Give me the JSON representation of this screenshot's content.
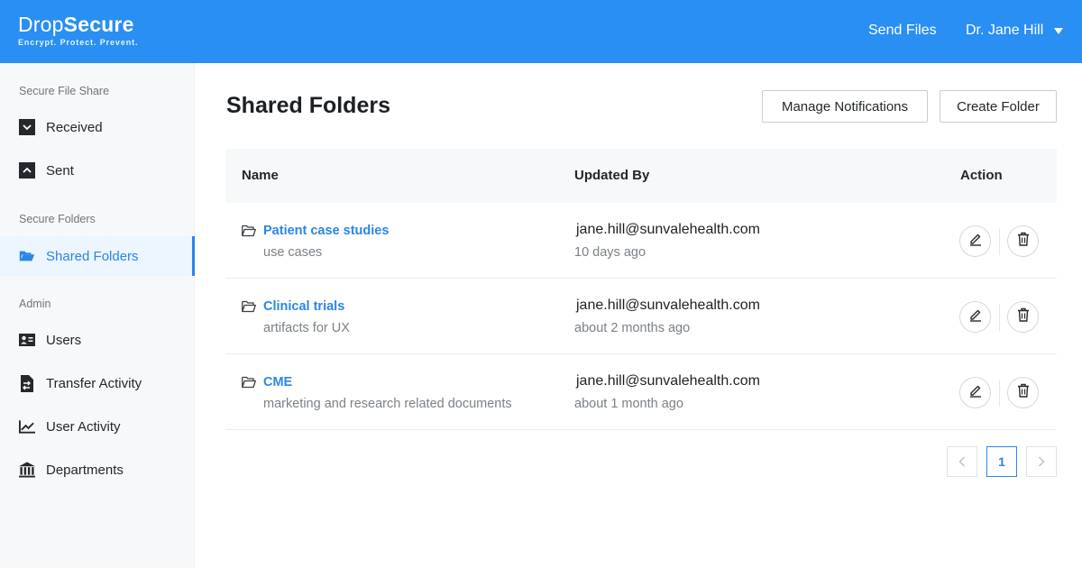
{
  "brand": {
    "name_light": "Drop",
    "name_bold": "Secure",
    "tagline": "Encrypt. Protect. Prevent."
  },
  "header": {
    "send_files": "Send Files",
    "user_name": "Dr. Jane Hill"
  },
  "sidebar": {
    "sections": [
      {
        "label": "Secure File Share"
      },
      {
        "label": "Secure Folders"
      },
      {
        "label": "Admin"
      }
    ],
    "items": [
      {
        "label": "Received",
        "icon": "chevron-down-square-icon"
      },
      {
        "label": "Sent",
        "icon": "chevron-up-square-icon"
      },
      {
        "label": "Shared Folders",
        "icon": "folder-open-icon",
        "active": true
      },
      {
        "label": "Users",
        "icon": "id-card-icon"
      },
      {
        "label": "Transfer Activity",
        "icon": "file-transfer-icon"
      },
      {
        "label": "User Activity",
        "icon": "line-chart-icon"
      },
      {
        "label": "Departments",
        "icon": "bank-icon"
      }
    ]
  },
  "main": {
    "title": "Shared Folders",
    "buttons": {
      "manage_notifications": "Manage Notifications",
      "create_folder": "Create Folder"
    },
    "table": {
      "columns": [
        "Name",
        "Updated By",
        "Action"
      ],
      "rows": [
        {
          "name": "Patient case studies",
          "description": "use cases",
          "updated_by": "jane.hill@sunvalehealth.com",
          "updated": "10 days ago"
        },
        {
          "name": "Clinical trials",
          "description": "artifacts for UX",
          "updated_by": "jane.hill@sunvalehealth.com",
          "updated": "about 2 months ago"
        },
        {
          "name": "CME",
          "description": "marketing and research related documents",
          "updated_by": "jane.hill@sunvalehealth.com",
          "updated": "about 1 month ago"
        }
      ]
    },
    "pagination": {
      "current_page": "1"
    }
  },
  "colors": {
    "primary": "#2a8ff2",
    "link": "#2a86e6",
    "sidebar_bg": "#f7f8fa"
  }
}
